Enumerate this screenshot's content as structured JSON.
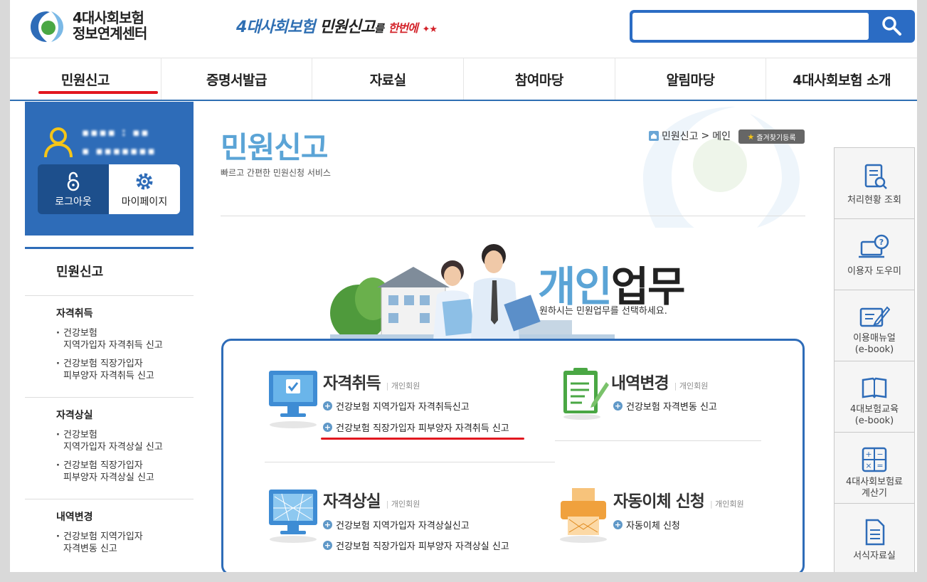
{
  "header": {
    "logo_line1": "4대사회보험",
    "logo_line2": "정보연계센터",
    "slogan_part1": "4대사회보험",
    "slogan_part2": "민원신고",
    "slogan_part3": "를",
    "slogan_part4": "한번에",
    "search_placeholder": ""
  },
  "nav": {
    "items": [
      {
        "label": "민원신고"
      },
      {
        "label": "증명서발급"
      },
      {
        "label": "자료실"
      },
      {
        "label": "참여마당"
      },
      {
        "label": "알림마당"
      },
      {
        "label": "4대사회보험 소개"
      }
    ]
  },
  "login_panel": {
    "logout_label": "로그아웃",
    "mypage_label": "마이페이지"
  },
  "lnb": {
    "title": "민원신고",
    "groups": [
      {
        "title": "자격취득",
        "links": [
          "건강보험\n지역가입자 자격취득 신고",
          "건강보험 직장가입자\n피부양자 자격취득 신고"
        ]
      },
      {
        "title": "자격상실",
        "links": [
          "건강보험\n지역가입자 자격상실 신고",
          "건강보험 직장가입자\n피부양자 자격상실 신고"
        ]
      },
      {
        "title": "내역변경",
        "links": [
          "건강보험 지역가입자\n자격변동 신고"
        ]
      }
    ]
  },
  "main": {
    "title": "민원신고",
    "subtitle": "빠르고 간편한 민원신청 서비스",
    "breadcrumb_1": "민원신고",
    "breadcrumb_sep": ">",
    "breadcrumb_2": "메인",
    "fav_label": "즐겨찾기등록",
    "hero_title_1": "개인",
    "hero_title_2": "업무",
    "hero_subtitle": "원하시는 민원업무를 선택하세요."
  },
  "tasks": {
    "acquire": {
      "title": "자격취득",
      "tag": "개인회원",
      "links": [
        "건강보험 지역가입자 자격취득신고",
        "건강보험 직장가입자 피부양자 자격취득 신고"
      ]
    },
    "change": {
      "title": "내역변경",
      "tag": "개인회원",
      "links": [
        "건강보험 자격변동 신고"
      ]
    },
    "loss": {
      "title": "자격상실",
      "tag": "개인회원",
      "links": [
        "건강보험 지역가입자 자격상실신고",
        "건강보험 직장가입자 피부양자 자격상실 신고"
      ]
    },
    "autopay": {
      "title": "자동이체 신청",
      "tag": "개인회원",
      "links": [
        "자동이체 신청"
      ]
    }
  },
  "quick_menu": [
    {
      "label": "처리현황 조회",
      "icon": "document-search-icon"
    },
    {
      "label": "이용자 도우미",
      "icon": "help-monitor-icon"
    },
    {
      "label": "이용매뉴얼\n(e-book)",
      "icon": "manual-pen-icon"
    },
    {
      "label": "4대보험교육\n(e-book)",
      "icon": "book-icon"
    },
    {
      "label": "4대사회보험료\n계산기",
      "icon": "calculator-icon"
    },
    {
      "label": "서식자료실",
      "icon": "form-document-icon"
    }
  ],
  "colors": {
    "primary_blue": "#2e6cb8",
    "accent_red": "#e2171f",
    "title_blue": "#5ba4d6"
  }
}
